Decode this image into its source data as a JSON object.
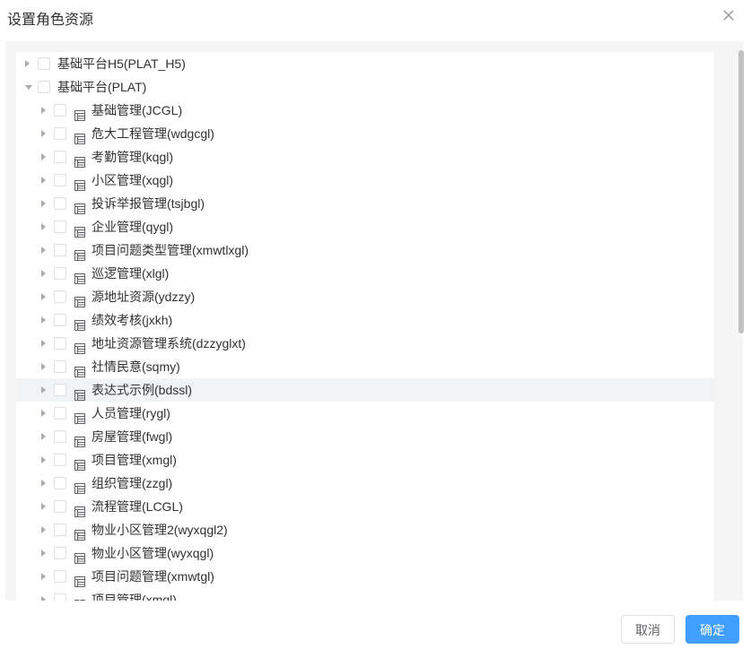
{
  "dialog": {
    "title": "设置角色资源",
    "close_icon": "close-icon"
  },
  "tree": {
    "roots": [
      {
        "label": "基础平台H5(PLAT_H5)",
        "expanded": false
      },
      {
        "label": "基础平台(PLAT)",
        "expanded": true
      }
    ],
    "children": [
      {
        "label": "基础管理(JCGL)",
        "icon": "menu-table-icon"
      },
      {
        "label": "危大工程管理(wdgcgl)",
        "icon": "menu-table-icon"
      },
      {
        "label": "考勤管理(kqgl)",
        "icon": "menu-table-icon"
      },
      {
        "label": "小区管理(xqgl)",
        "icon": "menu-table-icon"
      },
      {
        "label": "投诉举报管理(tsjbgl)",
        "icon": "menu-table-icon"
      },
      {
        "label": "企业管理(qygl)",
        "icon": "menu-table-icon"
      },
      {
        "label": "项目问题类型管理(xmwtlxgl)",
        "icon": "menu-table-icon"
      },
      {
        "label": "巡逻管理(xlgl)",
        "icon": "menu-table-icon"
      },
      {
        "label": "源地址资源(ydzzy)",
        "icon": "menu-table-icon"
      },
      {
        "label": "绩效考核(jxkh)",
        "icon": "menu-table-icon"
      },
      {
        "label": "地址资源管理系统(dzzyglxt)",
        "icon": "menu-table-icon"
      },
      {
        "label": "社情民意(sqmy)",
        "icon": "menu-table-icon"
      },
      {
        "label": "表达式示例(bdssl)",
        "icon": "menu-table-icon",
        "hover": true
      },
      {
        "label": "人员管理(rygl)",
        "icon": "menu-table-icon"
      },
      {
        "label": "房屋管理(fwgl)",
        "icon": "menu-table-icon"
      },
      {
        "label": "项目管理(xmgl)",
        "icon": "menu-table-icon"
      },
      {
        "label": "组织管理(zzgl)",
        "icon": "menu-table-icon"
      },
      {
        "label": "流程管理(LCGL)",
        "icon": "menu-table-icon"
      },
      {
        "label": "物业小区管理2(wyxqgl2)",
        "icon": "menu-table-icon"
      },
      {
        "label": "物业小区管理(wyxqgl)",
        "icon": "menu-table-icon"
      },
      {
        "label": "项目问题管理(xmwtgl)",
        "icon": "menu-table-icon"
      },
      {
        "label": "项目管理(xmgl)",
        "icon": "menu-grid-icon"
      }
    ]
  },
  "footer": {
    "cancel_label": "取消",
    "confirm_label": "确定"
  },
  "colors": {
    "primary": "#409eff",
    "panel_bg": "#f5f5f5"
  }
}
